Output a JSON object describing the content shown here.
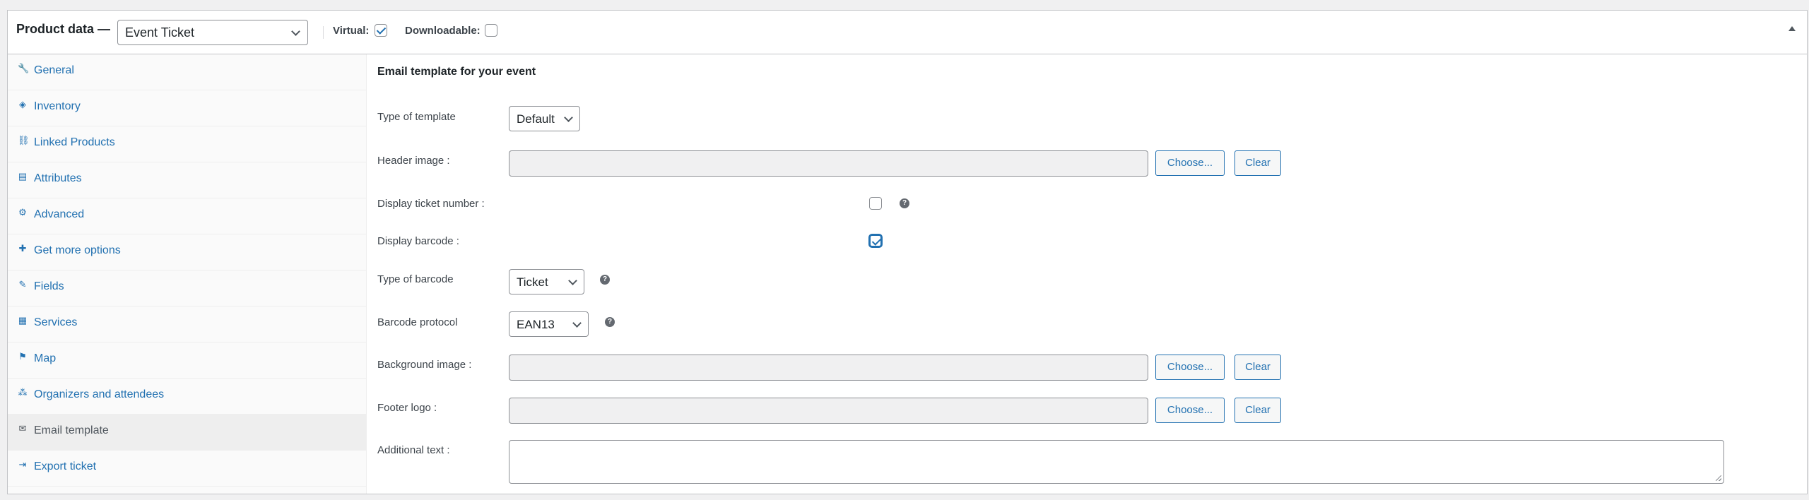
{
  "header": {
    "title": "Product data —",
    "product_type": "Event Ticket",
    "virtual_label": "Virtual:",
    "virtual_checked": true,
    "downloadable_label": "Downloadable:",
    "downloadable_checked": false
  },
  "sidebar": {
    "items": [
      {
        "label": "General",
        "icon": "wrench-icon",
        "glyph": "🔧"
      },
      {
        "label": "Inventory",
        "icon": "tag-icon",
        "glyph": "◈"
      },
      {
        "label": "Linked Products",
        "icon": "link-icon",
        "glyph": "⛓"
      },
      {
        "label": "Attributes",
        "icon": "list-icon",
        "glyph": "▤"
      },
      {
        "label": "Advanced",
        "icon": "gear-icon",
        "glyph": "⚙"
      },
      {
        "label": "Get more options",
        "icon": "plugin-icon",
        "glyph": "✚"
      },
      {
        "label": "Fields",
        "icon": "pencil-icon",
        "glyph": "✎"
      },
      {
        "label": "Services",
        "icon": "grid-icon",
        "glyph": "▦"
      },
      {
        "label": "Map",
        "icon": "map-icon",
        "glyph": "⚑"
      },
      {
        "label": "Organizers and attendees",
        "icon": "groups-icon",
        "glyph": "⁂"
      },
      {
        "label": "Email template",
        "icon": "envelope-icon",
        "glyph": "✉"
      },
      {
        "label": "Export ticket",
        "icon": "export-icon",
        "glyph": "⇥"
      }
    ],
    "active_index": 10
  },
  "main": {
    "section_title": "Email template for your event",
    "type_of_template_label": "Type of template",
    "type_of_template_value": "Default",
    "header_image_label": "Header image :",
    "display_ticket_number_label": "Display ticket number :",
    "display_ticket_number_checked": false,
    "display_barcode_label": "Display barcode :",
    "display_barcode_checked": true,
    "type_of_barcode_label": "Type of barcode",
    "type_of_barcode_value": "Ticket",
    "barcode_protocol_label": "Barcode protocol",
    "barcode_protocol_value": "EAN13",
    "background_image_label": "Background image :",
    "footer_logo_label": "Footer logo :",
    "additional_text_label": "Additional text :",
    "choose_label": "Choose...",
    "clear_label": "Clear",
    "help_glyph": "?"
  },
  "colors": {
    "accent": "#2271b1",
    "border": "#c3c4c7",
    "background": "#f0f0f1"
  }
}
